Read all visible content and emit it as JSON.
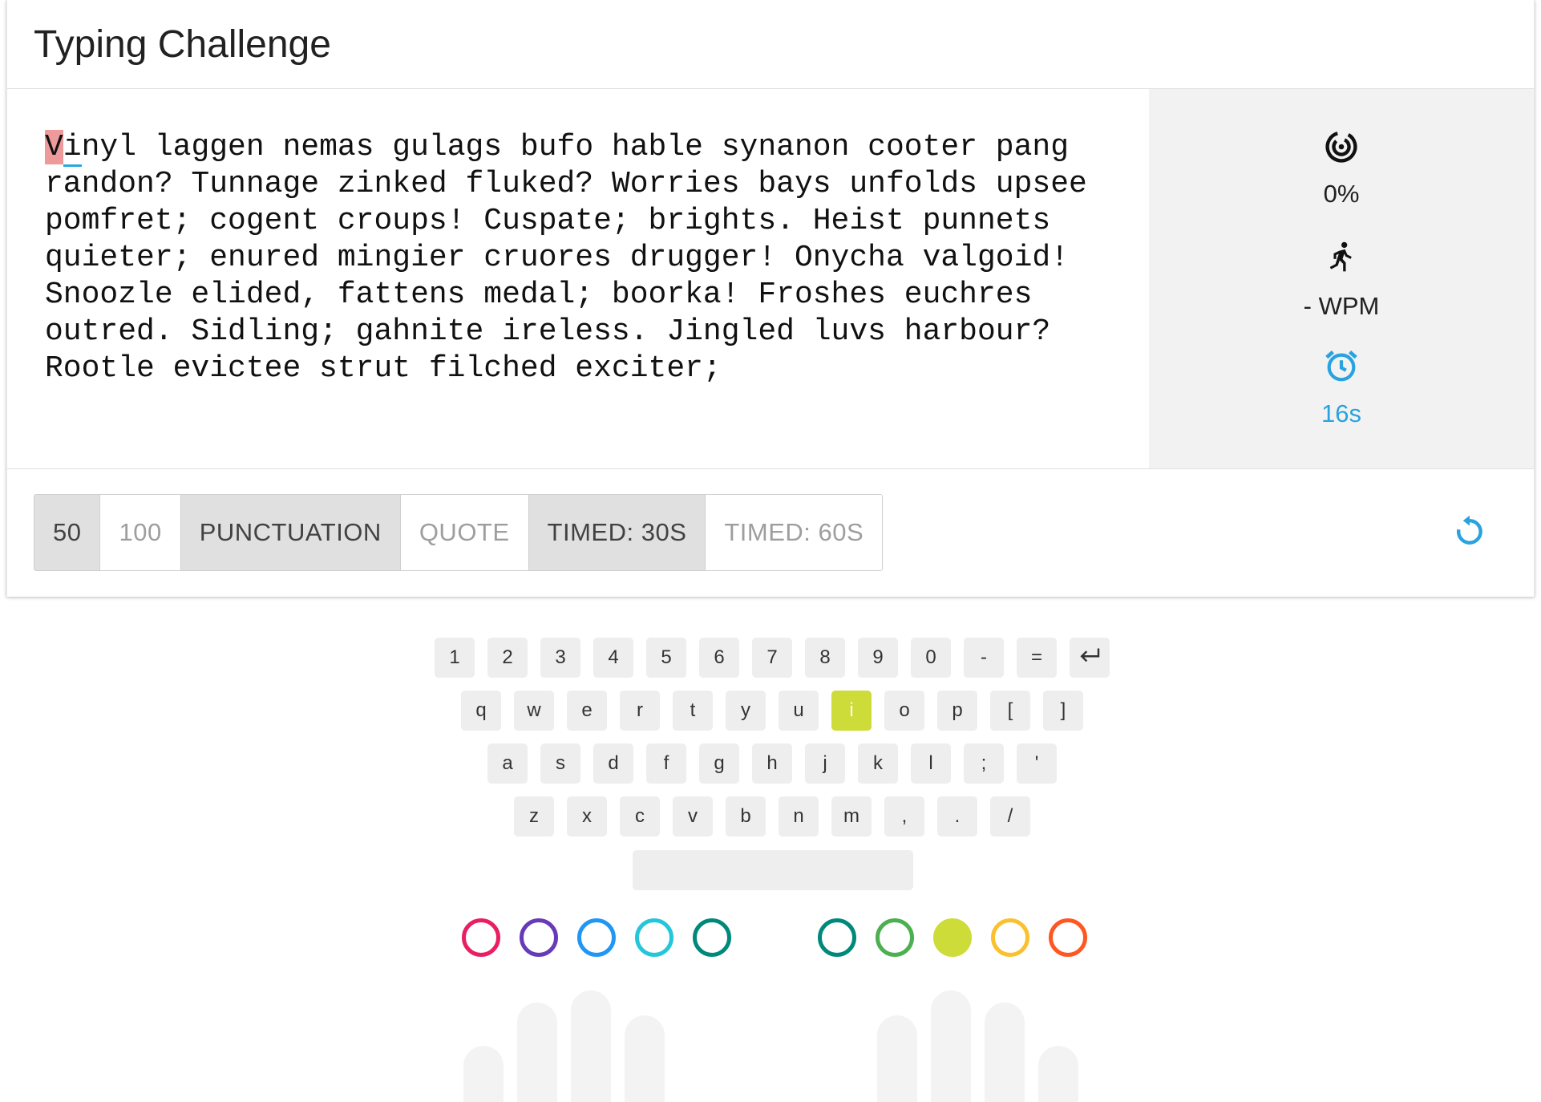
{
  "app": {
    "title": "Typing Challenge"
  },
  "text": {
    "current_char": "V",
    "next_char": "i",
    "rest": "nyl laggen nemas gulags bufo hable synanon cooter pang randon? Tunnage zinked fluked? Worries bays unfolds upsee pomfret; cogent croups! Cuspate; brights. Heist punnets quieter; enured mingier cruores drugger! Onycha valgoid! Snoozle elided, fattens medal; boorka! Froshes euchres outred. Sidling; gahnite ireless. Jingled luvs harbour? Rootle evictee strut filched exciter;"
  },
  "stats": {
    "accuracy": {
      "icon": "target-icon",
      "value": "0%"
    },
    "speed": {
      "icon": "runner-icon",
      "value": "- WPM"
    },
    "timer": {
      "icon": "alarm-clock-icon",
      "value": "16s",
      "color": "#29a3df"
    }
  },
  "options": [
    {
      "label": "50",
      "active": true
    },
    {
      "label": "100",
      "active": false
    },
    {
      "label": "PUNCTUATION",
      "active": true
    },
    {
      "label": "QUOTE",
      "active": false
    },
    {
      "label": "TIMED: 30S",
      "active": true
    },
    {
      "label": "TIMED: 60S",
      "active": false
    }
  ],
  "reload": {
    "icon": "reload-icon",
    "color": "#29a3df"
  },
  "keyboard": {
    "row1": [
      "1",
      "2",
      "3",
      "4",
      "5",
      "6",
      "7",
      "8",
      "9",
      "0",
      "-",
      "="
    ],
    "row1_enter_icon": "enter-icon",
    "row2": [
      "q",
      "w",
      "e",
      "r",
      "t",
      "y",
      "u",
      "i",
      "o",
      "p",
      "[",
      "]"
    ],
    "row3": [
      "a",
      "s",
      "d",
      "f",
      "g",
      "h",
      "j",
      "k",
      "l",
      ";",
      "'"
    ],
    "row4": [
      "z",
      "x",
      "c",
      "v",
      "b",
      "n",
      "m",
      ",",
      ".",
      "/"
    ],
    "highlighted_key": "i",
    "highlight_color": "#cddc39"
  },
  "finger_indicators": {
    "left": [
      "#e91e63",
      "#673ab7",
      "#2196f3",
      "#26c6da",
      "#00897b"
    ],
    "right": [
      "#00897b",
      "#4caf50",
      "#cddc39",
      "#fbc02d",
      "#ff5722"
    ],
    "active_finger": "right-3"
  }
}
